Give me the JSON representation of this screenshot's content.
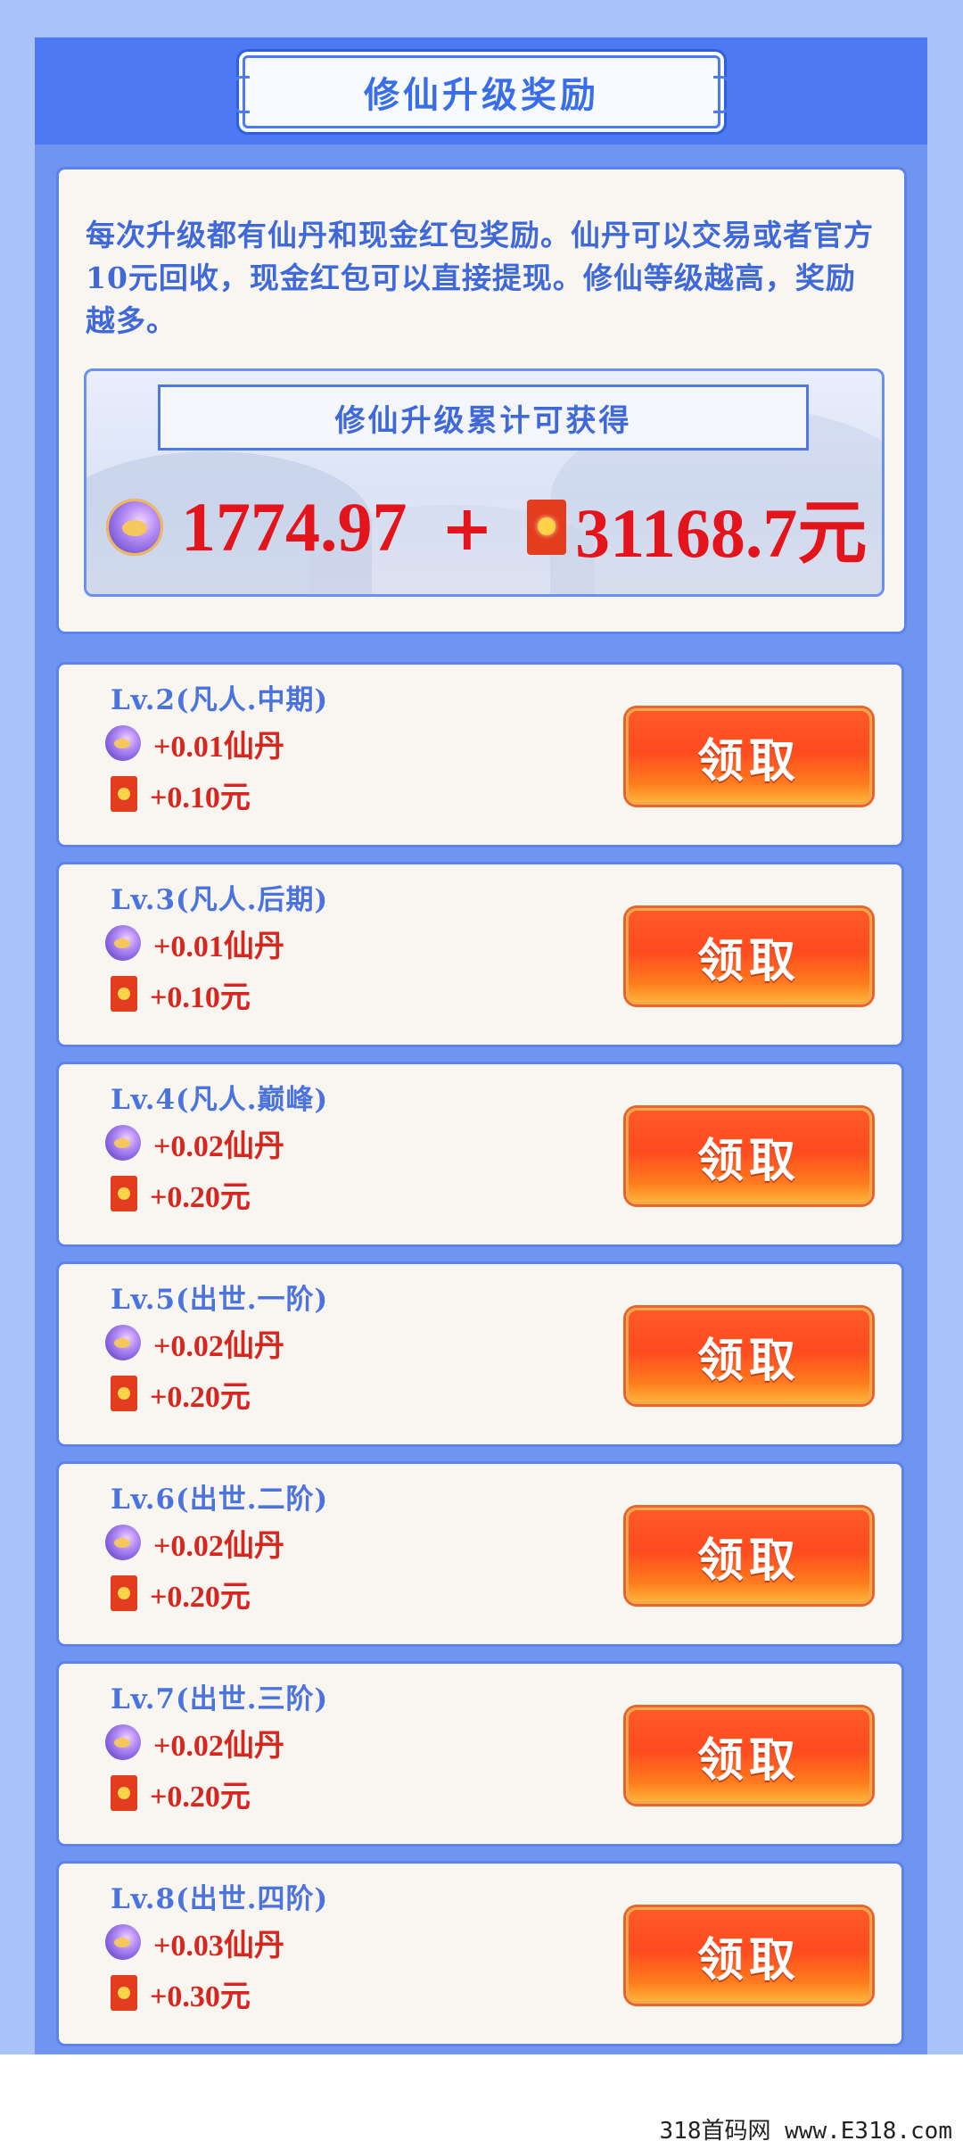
{
  "header": {
    "title": "修仙升级奖励"
  },
  "info": {
    "text": "每次升级都有仙丹和现金红包奖励。仙丹可以交易或者官方10元回收，现金红包可以直接提现。修仙等级越高，奖励越多。",
    "summary_label": "修仙升级累计可获得",
    "pill_total": "1774.97",
    "plus": "+",
    "cash_total": "31168.7元"
  },
  "levels": [
    {
      "title": "Lv.2(凡人.中期)",
      "pill": "+0.01仙丹",
      "cash": "+0.10元",
      "button": "领取"
    },
    {
      "title": "Lv.3(凡人.后期)",
      "pill": "+0.01仙丹",
      "cash": "+0.10元",
      "button": "领取"
    },
    {
      "title": "Lv.4(凡人.巅峰)",
      "pill": "+0.02仙丹",
      "cash": "+0.20元",
      "button": "领取"
    },
    {
      "title": "Lv.5(出世.一阶)",
      "pill": "+0.02仙丹",
      "cash": "+0.20元",
      "button": "领取"
    },
    {
      "title": "Lv.6(出世.二阶)",
      "pill": "+0.02仙丹",
      "cash": "+0.20元",
      "button": "领取"
    },
    {
      "title": "Lv.7(出世.三阶)",
      "pill": "+0.02仙丹",
      "cash": "+0.20元",
      "button": "领取"
    },
    {
      "title": "Lv.8(出世.四阶)",
      "pill": "+0.03仙丹",
      "cash": "+0.30元",
      "button": "领取"
    }
  ],
  "watermark": "318首码网 www.E318.com",
  "colors": {
    "page_bg": "#a9c3fa",
    "panel": "#6f95f1",
    "header": "#4d79f4",
    "accent_text": "#3f69d8",
    "reward_red": "#d6261d",
    "button_orange": "#ff4b1f"
  }
}
